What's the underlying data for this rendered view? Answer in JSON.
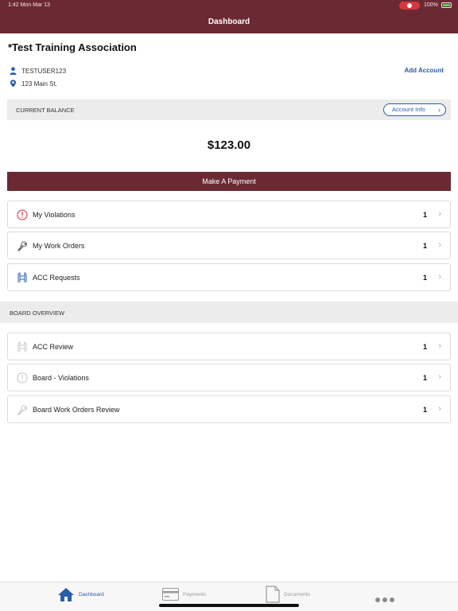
{
  "status_bar": {
    "time": "1:42  Mon Mar 13",
    "battery": "100%"
  },
  "navbar": {
    "title": "Dashboard"
  },
  "account": {
    "org_name": "*Test Training Association",
    "username": "TESTUSER123",
    "address": "123 Main St.",
    "add_account_label": "Add Account"
  },
  "balance": {
    "section_label": "CURRENT BALANCE",
    "account_info_label": "Account Info",
    "amount": "$123.00",
    "pay_button_label": "Make A Payment"
  },
  "my_items": [
    {
      "label": "My Violations",
      "count": "1",
      "icon": "alert-circle-icon"
    },
    {
      "label": "My Work Orders",
      "count": "1",
      "icon": "wrench-icon"
    },
    {
      "label": "ACC Requests",
      "count": "1",
      "icon": "acc-request-icon"
    }
  ],
  "board": {
    "section_label": "BOARD OVERVIEW",
    "items": [
      {
        "label": "ACC Review",
        "count": "1",
        "icon": "acc-request-icon"
      },
      {
        "label": "Board - Violations",
        "count": "1",
        "icon": "alert-circle-icon"
      },
      {
        "label": "Board Work Orders Review",
        "count": "1",
        "icon": "wrench-icon"
      }
    ]
  },
  "tabs": [
    {
      "label": "Dashboard",
      "icon": "home-icon",
      "active": true
    },
    {
      "label": "Payments",
      "icon": "credit-card-icon",
      "active": false
    },
    {
      "label": "Documents",
      "icon": "document-icon",
      "active": false
    }
  ],
  "colors": {
    "brand": "#6b2a33",
    "accent": "#2a5da8",
    "alert": "#d9363e"
  }
}
